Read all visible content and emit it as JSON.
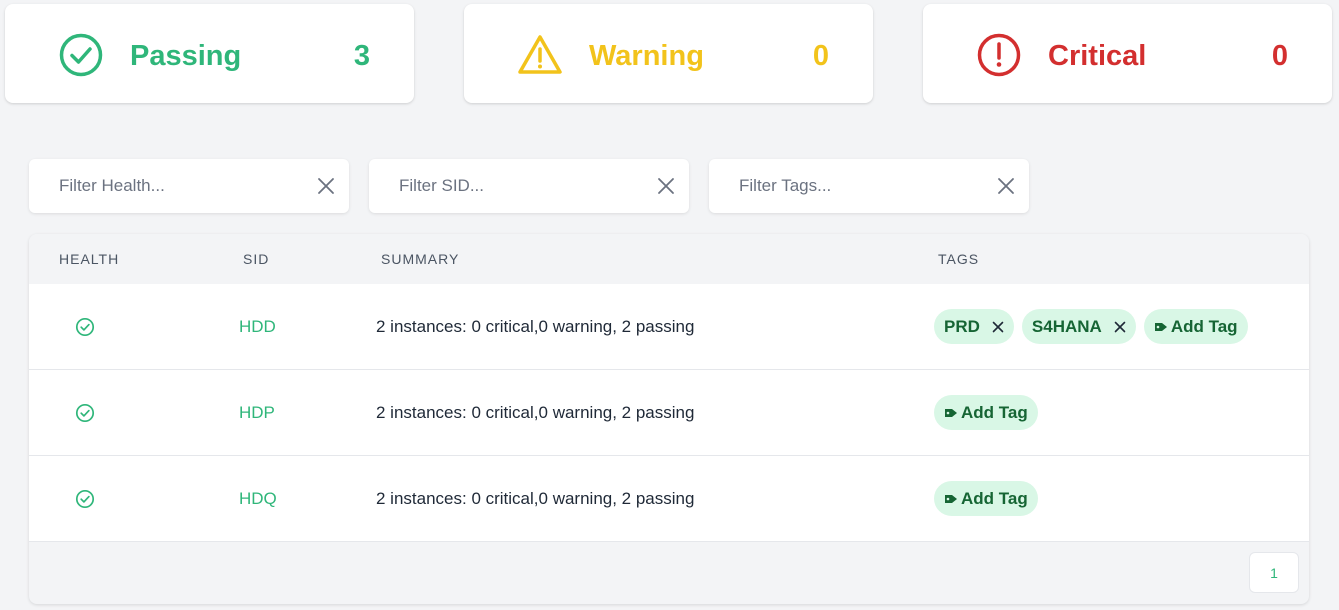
{
  "summary": {
    "passing": {
      "label": "Passing",
      "count": "3",
      "icon": "check-circle-icon",
      "color": "#2fb67a"
    },
    "warning": {
      "label": "Warning",
      "count": "0",
      "icon": "warning-triangle-icon",
      "color": "#f2c31b"
    },
    "critical": {
      "label": "Critical",
      "count": "0",
      "icon": "exclamation-circle-icon",
      "color": "#d32f2f"
    }
  },
  "filters": {
    "health": {
      "placeholder": "Filter Health..."
    },
    "sid": {
      "placeholder": "Filter SID..."
    },
    "tags": {
      "placeholder": "Filter Tags..."
    }
  },
  "table": {
    "columns": [
      "HEALTH",
      "SID",
      "SUMMARY",
      "TAGS"
    ],
    "rows": [
      {
        "health": "passing",
        "sid": "HDD",
        "summary": "2 instances: 0 critical,0 warning, 2 passing",
        "tags": [
          "PRD",
          "S4HANA"
        ],
        "add_tag": "Add Tag"
      },
      {
        "health": "passing",
        "sid": "HDP",
        "summary": "2 instances: 0 critical,0 warning, 2 passing",
        "tags": [],
        "add_tag": "Add Tag"
      },
      {
        "health": "passing",
        "sid": "HDQ",
        "summary": "2 instances: 0 critical,0 warning, 2 passing",
        "tags": [],
        "add_tag": "Add Tag"
      }
    ]
  },
  "pagination": {
    "current_page": "1"
  }
}
